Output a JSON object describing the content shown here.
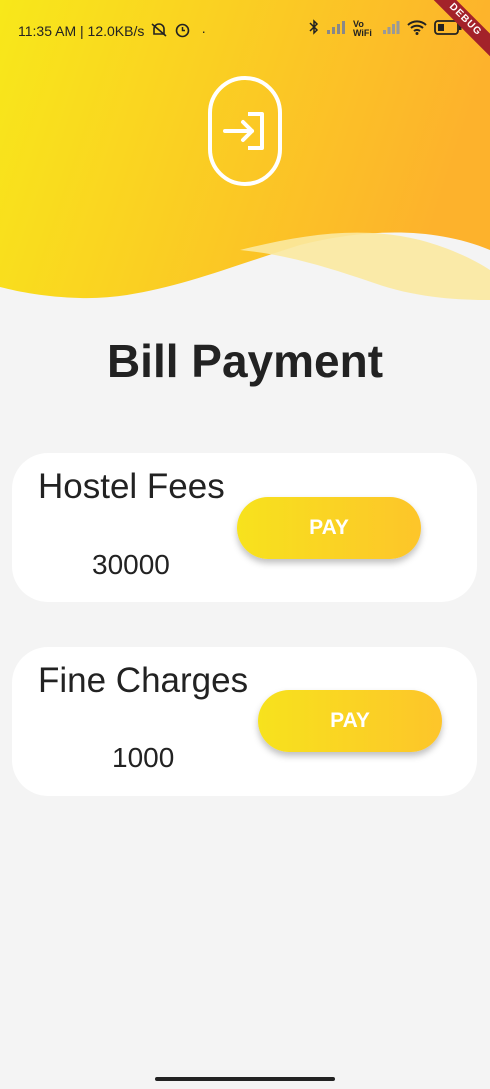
{
  "status_bar": {
    "time_speed": "11:35 AM | 12.0KB/s",
    "dot": "·",
    "network_label": "Vo WiFi",
    "debug_label": "DEBUG"
  },
  "page": {
    "title": "Bill Payment"
  },
  "bills": [
    {
      "name": "Hostel Fees",
      "amount": "30000",
      "pay_label": "PAY"
    },
    {
      "name": "Fine Charges",
      "amount": "1000",
      "pay_label": "PAY"
    }
  ],
  "colors": {
    "gradient_start": "#f7e21d",
    "gradient_end": "#fdb52a",
    "background": "#f4f4f4"
  },
  "icons": [
    "login-icon",
    "bluetooth-icon",
    "wifi-icon",
    "battery-icon",
    "alarm-icon",
    "mute-icon"
  ]
}
